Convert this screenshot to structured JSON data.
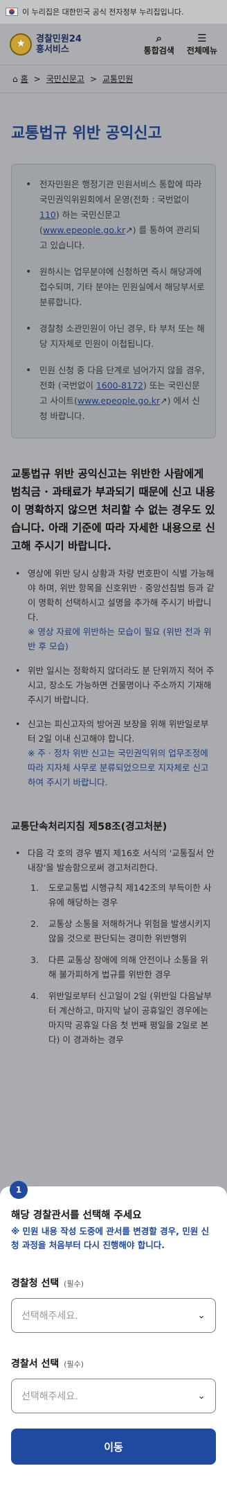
{
  "gov_banner": "이 누리집은 대한민국 공식 전자정부 누리집입니다.",
  "brand": {
    "line1": "경찰민원24",
    "line2": "홍서비스"
  },
  "header": {
    "search_label": "통합검색",
    "menu_label": "전체메뉴"
  },
  "breadcrumb": [
    "홈",
    "국민신문고",
    "교통민원"
  ],
  "page_title": "교통법규 위반 공익신고",
  "notice": [
    {
      "text_a": "전자민원은 행정기관 민원서비스 통합에 따라 국민권익위원회에서 운영(전화 : 국번없이 ",
      "link": "110",
      "text_b": ") 하는 국민신문고 (",
      "link2": "www.epeople.go.kr",
      "text_c": ") 를 통하여 관리되고 있습니다."
    },
    {
      "text": "원하시는 업무분야에 신청하면 즉시 해당과에 접수되며, 기타 분야는 민원실에서 해당부서로 분류합니다."
    },
    {
      "text": "경찰청 소관민원이 아닌 경우, 타 부처 또는 해당 지자체로 민원이 이첩됩니다."
    },
    {
      "text_a": "민원 신청 중 다음 단계로 넘어가지 않을 경우, 전화 (국번없이 ",
      "link": "1600-8172",
      "text_b": ") 또는 국민신문고 사이트(",
      "link2": "www.epeople.go.kr",
      "text_c": ") 에서 신청 바랍니다."
    }
  ],
  "lead": "교통법규 위반 공익신고는 위반한 사람에게 범칙금 · 과태료가 부과되기 때문에 신고 내용이 명확하지 않으면 처리할 수 없는 경우도 있습니다. 아래 기준에 따라 자세한 내용으로 신고해 주시기 바랍니다.",
  "criteria": [
    {
      "text": "영상에 위반 당시 상황과 차량 번호판이 식별 가능해야 하며, 위반 항목을 신호위반 · 중앙선침범 등과 같이 명확히 선택하시고 설명을 추가해 주시기 바랍니다.",
      "note": "※ 영상 자료에 위반하는 모습이 필요 (위반 전과 위반 후 모습)"
    },
    {
      "text": "위반 일시는 정확하지 않더라도 분 단위까지 적어 주시고, 장소도 가능하면 건물명이나 주소까지 기재해 주시기 바랍니다.",
      "note": ""
    },
    {
      "text": "신고는 피신고자의 방어권 보장을 위해 위반일로부터 2일 이내 신고해야 합니다.",
      "note": "※ 주 · 정차 위반 신고는 국민권익위의 업무조정에 따라 지자체 사무로 분류되었으므로 지자체로 신고하여 주시기 바랍니다."
    }
  ],
  "rule_title": "교통단속처리지침 제58조(경고처분)",
  "rule_intro": "다음 각 호의 경우 별지 제16호 서식의 '교통질서 안내장'을 발송함으로써 경고처리한다.",
  "rule_items": [
    {
      "num": "1.",
      "text": "도로교통법 시행규칙 제142조의 부득이한 사유에 해당하는 경우"
    },
    {
      "num": "2.",
      "text": "교통상 소통을 저해하거나 위험을 발생시키지 않을 것으로 판단되는 경미한 위반행위"
    },
    {
      "num": "3.",
      "text": "다른 교통상 장애에 의해 안전이나 소통을 위해 불가피하게 법규를 위반한 경우"
    },
    {
      "num": "4.",
      "text": "위반일로부터 신고일이 2일 (위반일 다음날부터 계산하고, 마지막 날이 공휴일인 경우에는 마지막 공휴일 다음 첫 번째 평일을 2일로 본다) 이 경과하는 경우"
    }
  ],
  "sheet": {
    "step": "1",
    "title": "해당 경찰관서를 선택해 주세요",
    "warn": "※ 민원 내용 작성 도중에 관서를 변경할 경우, 민원 신청 과정을 처음부터 다시 진행해야 합니다.",
    "agency_label": "경찰청 선택",
    "station_label": "경찰서 선택",
    "required": "(필수)",
    "placeholder": "선택해주세요.",
    "submit": "이동"
  }
}
